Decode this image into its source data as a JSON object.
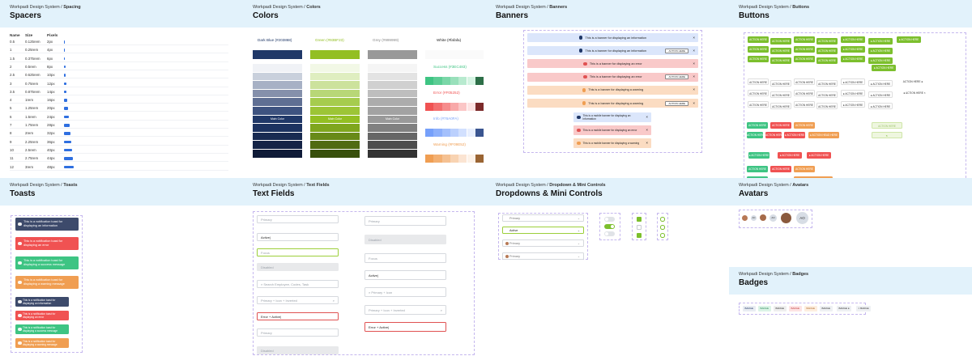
{
  "sections": {
    "spacers": {
      "crumb_prefix": "Workpadi Design System / ",
      "crumb_bold": "Spacing",
      "title": "Spacers"
    },
    "colors": {
      "crumb_prefix": "Workpadi Design System / ",
      "crumb_bold": "Colors",
      "title": "Colors"
    },
    "banners": {
      "crumb_prefix": "Workpadi Design System / ",
      "crumb_bold": "Banners",
      "title": "Banners"
    },
    "buttons": {
      "crumb_prefix": "Workpadi Design System / ",
      "crumb_bold": "Buttons",
      "title": "Buttons"
    },
    "toasts": {
      "crumb_prefix": "Workpadi Design System / ",
      "crumb_bold": "Toasts",
      "title": "Toasts"
    },
    "textfields": {
      "crumb_prefix": "Workpadi Design System / ",
      "crumb_bold": "Text Fields",
      "title": "Text Fields"
    },
    "dropdowns": {
      "crumb_prefix": "Workpadi Design System / ",
      "crumb_bold": "Dropdown & Mini Controls",
      "title": "Dropdowns & Mini Controls"
    },
    "avatars": {
      "crumb_prefix": "Workpadi Design System / ",
      "crumb_bold": "Avatars",
      "title": "Avatars"
    },
    "badges": {
      "crumb_prefix": "Workpadi Design System / ",
      "crumb_bold": "Badges",
      "title": "Badges"
    }
  },
  "spacers": {
    "headers": {
      "name": "Name",
      "size": "Size",
      "pixels": "Pixels"
    },
    "rows": [
      {
        "name": "0.5",
        "size": "0.125rem",
        "px": "2px",
        "value": 2
      },
      {
        "name": "1",
        "size": "0.25rem",
        "px": "4px",
        "value": 4
      },
      {
        "name": "1.5",
        "size": "0.375rem",
        "px": "6px",
        "value": 6
      },
      {
        "name": "2",
        "size": "0.5rem",
        "px": "8px",
        "value": 8
      },
      {
        "name": "2.5",
        "size": "0.625rem",
        "px": "10px",
        "value": 10
      },
      {
        "name": "3",
        "size": "0.75rem",
        "px": "12px",
        "value": 12
      },
      {
        "name": "3.5",
        "size": "0.875rem",
        "px": "14px",
        "value": 14
      },
      {
        "name": "4",
        "size": "1rem",
        "px": "16px",
        "value": 16
      },
      {
        "name": "5",
        "size": "1.25rem",
        "px": "20px",
        "value": 20
      },
      {
        "name": "6",
        "size": "1.5rem",
        "px": "24px",
        "value": 24
      },
      {
        "name": "7",
        "size": "1.75rem",
        "px": "28px",
        "value": 28
      },
      {
        "name": "8",
        "size": "2rem",
        "px": "32px",
        "value": 32
      },
      {
        "name": "9",
        "size": "2.25rem",
        "px": "36px",
        "value": 36
      },
      {
        "name": "10",
        "size": "2.5rem",
        "px": "40px",
        "value": 40
      },
      {
        "name": "11",
        "size": "2.75rem",
        "px": "44px",
        "value": 44
      },
      {
        "name": "12",
        "size": "3rem",
        "px": "48px",
        "value": 48
      }
    ]
  },
  "colors": {
    "columns": [
      {
        "name": "Dark Blue (#203868)",
        "color": "#203868",
        "main_label": "Main Color",
        "shades": [
          "#f0f2f6",
          "#c9d0dc",
          "#a7b1c5",
          "#8590ab",
          "#5f6f93",
          "#3e5380",
          "#203868",
          "#1c3260",
          "#182a52",
          "#142346",
          "#0f1b38"
        ]
      },
      {
        "name": "Green (#93BF23)",
        "color": "#93bf23",
        "main_label": "Main Color",
        "shades": [
          "#f2f8e6",
          "#dfeec0",
          "#cce29c",
          "#b8d777",
          "#a6cc4e",
          "#9cc536",
          "#93bf23",
          "#7fa61e",
          "#688a18",
          "#506b12",
          "#38500c"
        ]
      },
      {
        "name": "Grey (#999999)",
        "color": "#999999",
        "main_label": "Main Color",
        "shades": [
          "#f5f5f5",
          "#e3e3e3",
          "#d0d0d0",
          "#bebebe",
          "#acacac",
          "#a2a2a2",
          "#999999",
          "#808080",
          "#666666",
          "#4d4d4d",
          "#333333"
        ]
      }
    ],
    "white": {
      "name": "White (#fafafa)",
      "color": "#fafafa"
    },
    "small": [
      {
        "name": "Success (#3EC483)",
        "color": "#3ec483",
        "shades": [
          "#3ec483",
          "#5ccd95",
          "#7ad7a8",
          "#99e0bb",
          "#b8eacf",
          "#d6f4e3",
          "#2d6f48"
        ]
      },
      {
        "name": "Error (#F05252)",
        "color": "#f05252",
        "shades": [
          "#f05252",
          "#f36f6f",
          "#f68c8c",
          "#f8a9a9",
          "#fbc6c6",
          "#fde3e3",
          "#7c2a2a"
        ]
      },
      {
        "name": "Info (#76A0FA)",
        "color": "#76a0fa",
        "shades": [
          "#76a0fa",
          "#8db0fb",
          "#a4c0fc",
          "#bbd0fd",
          "#d2e0fe",
          "#e8effe",
          "#3a5590"
        ]
      },
      {
        "name": "Warning (#F09E52)",
        "color": "#f09e52",
        "shades": [
          "#f09e52",
          "#f3b072",
          "#f5c192",
          "#f8d3b2",
          "#fbe4d2",
          "#fdf2e8",
          "#9a6433"
        ]
      }
    ]
  },
  "banners": {
    "action_label": "ACTION HERE",
    "items": [
      {
        "type": "info",
        "text": "This is a banner for displaying an information",
        "action": false
      },
      {
        "type": "info",
        "text": "This is a banner for displaying an information",
        "action": true
      },
      {
        "type": "error",
        "text": "This is a banner for displaying an error",
        "action": false
      },
      {
        "type": "error",
        "text": "This is a banner for displaying an error",
        "action": true
      },
      {
        "type": "warning",
        "text": "This is a banner for displaying a warning",
        "action": false
      },
      {
        "type": "warning",
        "text": "This is a banner for displaying a warning",
        "action": true
      }
    ],
    "mobile": [
      {
        "type": "info",
        "text": "This is a mobile banner for displaying an information"
      },
      {
        "type": "error",
        "text": "This is a mobile banner for displaying an error"
      },
      {
        "type": "warning",
        "text": "This is a mobile banner for displaying a warning"
      }
    ],
    "palette": {
      "info": {
        "bg": "#dbe6fb",
        "ic": "#203868"
      },
      "error": {
        "bg": "#f9c9c9",
        "ic": "#e05252"
      },
      "warning": {
        "bg": "#fbdcc2",
        "ic": "#f09e52"
      }
    }
  },
  "buttons": {
    "label": "ACTION HERE",
    "alt_label": "ACTION HEAD",
    "label3": "ACTION HEAD HERE"
  },
  "toasts": {
    "items": [
      {
        "type": "info",
        "text": "This is a notification toast for displaying an information"
      },
      {
        "type": "error",
        "text": "This is a notification toast for displaying an error"
      },
      {
        "type": "success",
        "text": "This is a notification toast for displaying a success message"
      },
      {
        "type": "warning",
        "text": "This is a notification toast for displaying a warning message"
      }
    ],
    "palette": {
      "info": "#3d4a6b",
      "error": "#f05252",
      "success": "#3ec483",
      "warning": "#f09e52"
    }
  },
  "textfields": {
    "left": [
      {
        "text": "Primary",
        "state": "normal"
      },
      {
        "text": "Active",
        "state": "active"
      },
      {
        "text": "Focus",
        "state": "focus"
      },
      {
        "text": "Disabled",
        "state": "disabled"
      },
      {
        "text": "Search Employee, Codes, Task",
        "state": "search"
      },
      {
        "text": "Primary + Icon + Inverted",
        "state": "icon"
      },
      {
        "text": "Error + Active",
        "state": "error"
      },
      {
        "text": "Primary",
        "state": "normal"
      },
      {
        "text": "Disabled",
        "state": "disabled"
      }
    ],
    "right": [
      {
        "text": "Primary",
        "state": "normal"
      },
      {
        "text": "Disabled",
        "state": "disabled"
      },
      {
        "text": "Focus",
        "state": "normal"
      },
      {
        "text": "Active",
        "state": "active"
      },
      {
        "text": "Primary + Icon",
        "state": "icon"
      },
      {
        "text": "Primary + Icon + Inverted",
        "state": "search"
      },
      {
        "text": "Error + Active",
        "state": "error"
      }
    ]
  },
  "dropdowns": {
    "items": [
      {
        "text": "Primary",
        "avatar": false,
        "active": false
      },
      {
        "text": "Active",
        "avatar": false,
        "active": true
      },
      {
        "text": "Primary",
        "avatar": true,
        "active": false
      },
      {
        "text": "Primary",
        "avatar": true,
        "active": false
      }
    ]
  },
  "avatars": {
    "initials": "AO"
  },
  "badges": {
    "label": "BADGE"
  }
}
